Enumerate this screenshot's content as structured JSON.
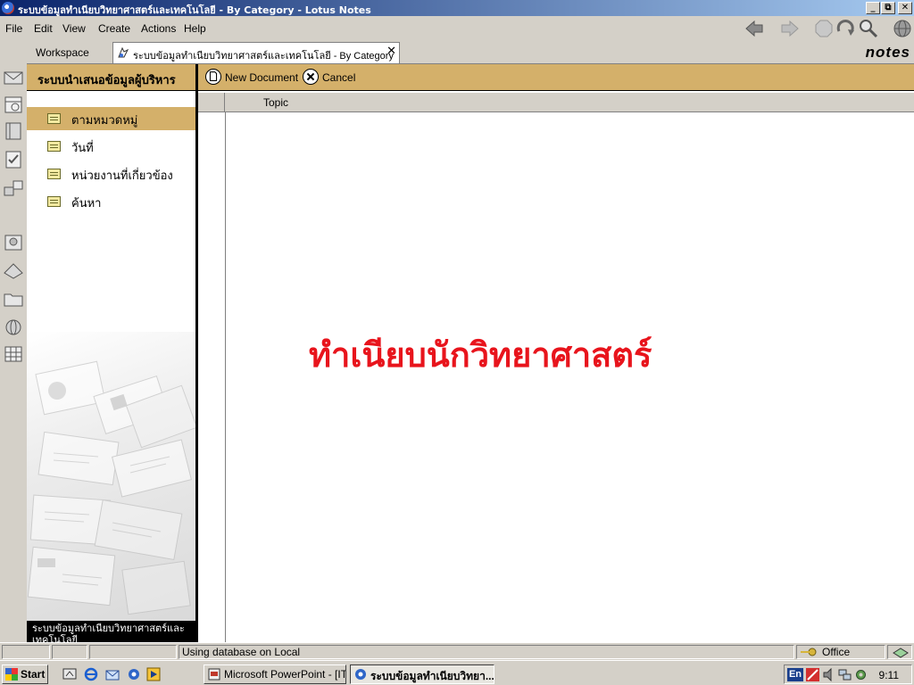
{
  "window": {
    "title": "ระบบข้อมูลทำเนียบวิทยาศาสตร์และเทคโนโลยี - By Category - Lotus Notes",
    "controls": [
      "_",
      "⧉",
      "✕"
    ]
  },
  "menu": [
    {
      "label": "File"
    },
    {
      "label": "Edit"
    },
    {
      "label": "View"
    },
    {
      "label": "Create"
    },
    {
      "label": "Actions"
    },
    {
      "label": "Help"
    }
  ],
  "tabs": {
    "workspace": "Workspace",
    "active": "ระบบข้อมูลทำเนียบวิทยาศาสตร์และเทคโนโลยี - By Category",
    "close": "✕"
  },
  "brand": "notes",
  "navigator": {
    "header": "ระบบนำเสนอข้อมูลผู้บริหาร",
    "items": [
      {
        "label": "ตามหมวดหมู่",
        "selected": true
      },
      {
        "label": "วันที่",
        "selected": false
      },
      {
        "label": "หน่วยงานที่เกี่ยวข้อง",
        "selected": false
      },
      {
        "label": "ค้นหา",
        "selected": false
      }
    ],
    "footer": "ระบบข้อมูลทำเนียบวิทยาศาสตร์และเทคโนโลยี"
  },
  "actions": {
    "new_document": "New Document",
    "cancel": "Cancel"
  },
  "view": {
    "column_topic": "Topic",
    "banner": "ทำเนียบนักวิทยาศาสตร์",
    "banner_color": "#e8141c"
  },
  "status": {
    "message": "Using database on Local",
    "location": "Office"
  },
  "taskbar": {
    "start": "Start",
    "buttons": [
      {
        "label": "Microsoft PowerPoint - [IT...",
        "active": false
      },
      {
        "label": "ระบบข้อมูลทำเนียบวิทยา...",
        "active": true
      }
    ],
    "lang": "En",
    "clock": "9:11"
  },
  "colors": {
    "accent": "#d4b06a",
    "titlebar_start": "#0a246a",
    "titlebar_end": "#a6caf0"
  }
}
